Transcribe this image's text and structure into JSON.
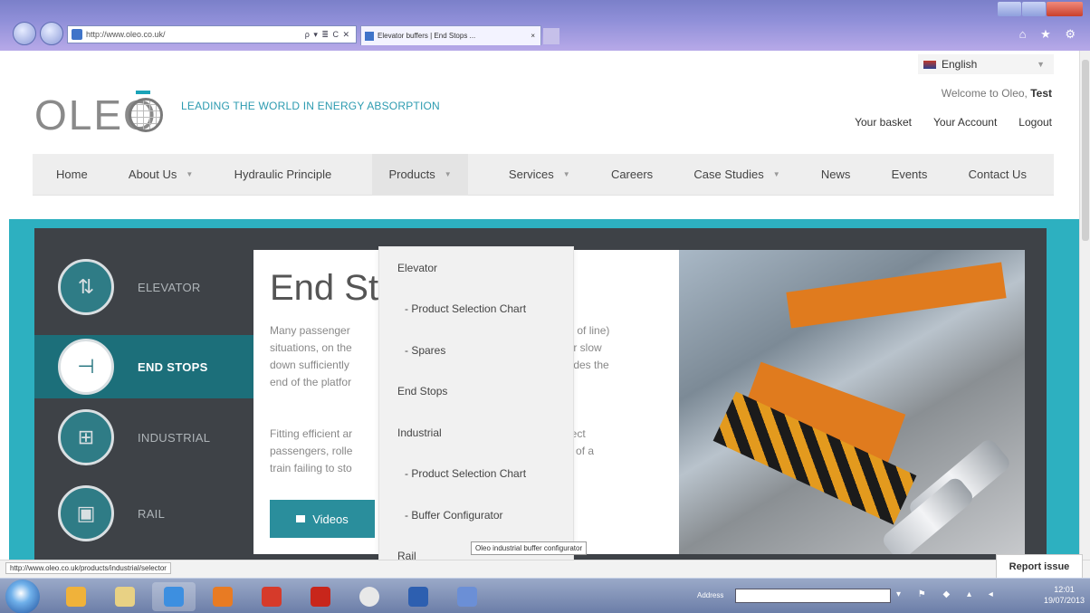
{
  "browser": {
    "address_text": "http://www.oleo.co.uk/",
    "address_tools": "ρ ▾ ≣ C ✕",
    "tab_title": "Elevator buffers | End Stops ...",
    "tab_close": "×",
    "icons_right": "⌂ ★ ⚙"
  },
  "header": {
    "logo_text": "OLEO",
    "tagline": "LEADING THE WORLD IN ENERGY ABSORPTION",
    "language": "English",
    "welcome_prefix": "Welcome to Oleo, ",
    "welcome_user": "Test",
    "links": [
      "Your basket",
      "Your Account",
      "Logout"
    ]
  },
  "nav": {
    "items": [
      "Home",
      "About Us",
      "Hydraulic Principle",
      "Products",
      "Services",
      "Careers",
      "Case Studies",
      "News",
      "Events",
      "Contact Us"
    ],
    "arrow": "▼"
  },
  "dropdown": {
    "items": [
      "Elevator",
      "- Product Selection Chart",
      "- Spares",
      "End Stops",
      "Industrial",
      "- Product Selection Chart",
      "- Buffer Configurator",
      "Rail"
    ],
    "tooltip": "Oleo industrial buffer configurator"
  },
  "sidebar": {
    "items": [
      "ELEVATOR",
      "END STOPS",
      "INDUSTRIAL",
      "RAIL"
    ]
  },
  "content": {
    "title": "End Stops",
    "para1_lines": [
      "Many passenger",
      "situations, on the",
      "down sufficiently",
      "end of the platfor"
    ],
    "para1_right": [
      "(end of line)",
      "up or slow",
      "verrides the"
    ],
    "para2_lines": [
      "Fitting efficient ar",
      "passengers, rolle",
      "train failing to sto"
    ],
    "para2_right": [
      "protect",
      "vent of a"
    ],
    "videos_button": "Videos"
  },
  "status": {
    "url": "http://www.oleo.co.uk/products/industrial/selector",
    "report_issue": "Report issue"
  },
  "taskbar": {
    "address_label": "Address",
    "clock_time": "12:01",
    "clock_date": "19/07/2013"
  },
  "colors": {
    "teal": "#2db0c0",
    "dark_panel": "#3e4247",
    "active_side": "#1c6f7a",
    "button": "#2a8e9c"
  }
}
